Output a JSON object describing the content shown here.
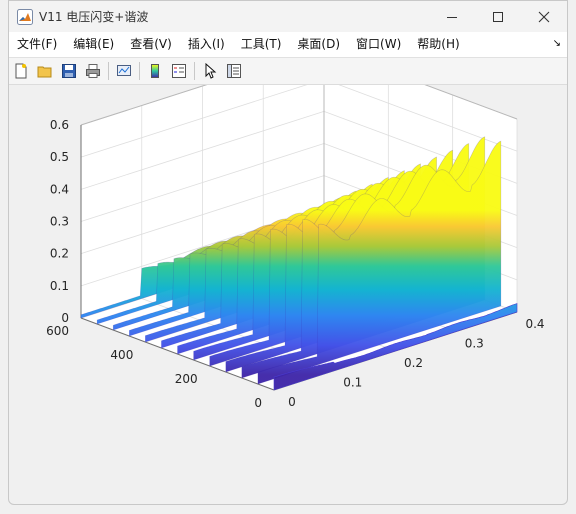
{
  "window": {
    "title": "V11 电压闪变+谐波",
    "controls": [
      "minimize-icon",
      "maximize-icon",
      "close-icon"
    ]
  },
  "menu": {
    "items": [
      "文件(F)",
      "编辑(E)",
      "查看(V)",
      "插入(I)",
      "工具(T)",
      "桌面(D)",
      "窗口(W)",
      "帮助(H)"
    ]
  },
  "toolbar": {
    "icons": [
      "new-figure-icon",
      "open-file-icon",
      "save-icon",
      "print-icon",
      "link-plot-icon",
      "insert-colorbar-icon",
      "insert-legend-icon",
      "edit-plot-icon",
      "property-inspector-icon"
    ]
  },
  "chart_data": {
    "type": "surface",
    "x": {
      "label": "",
      "ticks": [
        "0",
        "0.1",
        "0.2",
        "0.3",
        "0.4"
      ],
      "range": [
        0,
        0.4
      ]
    },
    "y": {
      "label": "",
      "ticks": [
        "0",
        "200",
        "400",
        "600"
      ],
      "range": [
        0,
        600
      ]
    },
    "z": {
      "label": "",
      "ticks": [
        "0",
        "0.1",
        "0.2",
        "0.3",
        "0.4",
        "0.5",
        "0.6"
      ],
      "range": [
        0,
        0.6
      ]
    },
    "grid": true,
    "colormap": [
      "#3e26a8",
      "#4763f7",
      "#1aa6d8",
      "#2ec8a0",
      "#a9c93a",
      "#f9c933",
      "#f9fb15"
    ],
    "step_time": 0.1,
    "peaks": [
      {
        "x": 0.1,
        "z": 0.45
      },
      {
        "x": 0.2,
        "z": 0.47
      },
      {
        "x": 0.3,
        "z": 0.5
      },
      {
        "x": 0.4,
        "z": 0.53
      }
    ],
    "trough_level": 0.37
  }
}
